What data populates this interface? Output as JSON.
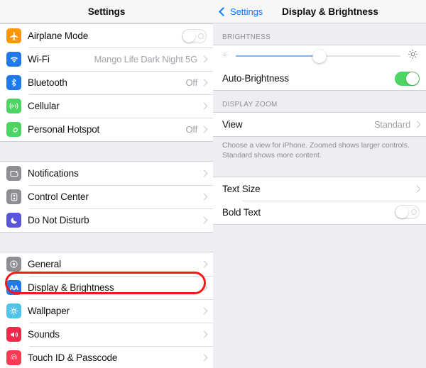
{
  "left_panel": {
    "navbar": {
      "title": "Settings"
    },
    "groups": [
      {
        "name": "connectivity",
        "rows": [
          {
            "label": "Airplane Mode",
            "icon": "airplane-icon",
            "control": "toggle",
            "toggle_state": "off"
          },
          {
            "label": "Wi-Fi",
            "icon": "wifi-icon",
            "value": "Mango Life Dark Night 5G",
            "control": "chevron"
          },
          {
            "label": "Bluetooth",
            "icon": "bluetooth-icon",
            "value": "Off",
            "control": "chevron"
          },
          {
            "label": "Cellular",
            "icon": "cellular-icon",
            "value": "",
            "control": "chevron"
          },
          {
            "label": "Personal Hotspot",
            "icon": "hotspot-icon",
            "value": "Off",
            "control": "chevron"
          }
        ]
      },
      {
        "name": "notifications",
        "rows": [
          {
            "label": "Notifications",
            "icon": "notifications-icon",
            "value": "",
            "control": "chevron"
          },
          {
            "label": "Control Center",
            "icon": "control-center-icon",
            "value": "",
            "control": "chevron"
          },
          {
            "label": "Do Not Disturb",
            "icon": "do-not-disturb-icon",
            "value": "",
            "control": "chevron"
          }
        ]
      },
      {
        "name": "general",
        "rows": [
          {
            "label": "General",
            "icon": "general-gear-icon",
            "value": "",
            "control": "chevron"
          },
          {
            "label": "Display & Brightness",
            "icon": "display-brightness-icon",
            "value": "",
            "control": "chevron"
          },
          {
            "label": "Wallpaper",
            "icon": "wallpaper-icon",
            "value": "",
            "control": "chevron"
          },
          {
            "label": "Sounds",
            "icon": "sounds-icon",
            "value": "",
            "control": "chevron"
          },
          {
            "label": "Touch ID & Passcode",
            "icon": "touch-id-icon",
            "value": "",
            "control": "chevron"
          }
        ]
      }
    ]
  },
  "right_panel": {
    "navbar": {
      "back_label": "Settings",
      "title": "Display & Brightness"
    },
    "brightness": {
      "section_header": "BRIGHTNESS",
      "slider_value_percent": 51,
      "auto_brightness_label": "Auto-Brightness",
      "auto_brightness_state": "on"
    },
    "display_zoom": {
      "section_header": "DISPLAY ZOOM",
      "view_label": "View",
      "view_value": "Standard",
      "footer": "Choose a view for iPhone. Zoomed shows larger controls. Standard shows more content."
    },
    "text": {
      "text_size_label": "Text Size",
      "bold_text_label": "Bold Text",
      "bold_text_state": "off"
    }
  },
  "annotations": {
    "highlight_color": "#f81818",
    "highlighted_items": [
      "Display & Brightness",
      "DISPLAY ZOOM"
    ]
  },
  "colors": {
    "accent_blue": "#0a7cff",
    "toggle_green": "#4cd562",
    "background": "#eeeef2",
    "row_background": "#ffffff"
  }
}
